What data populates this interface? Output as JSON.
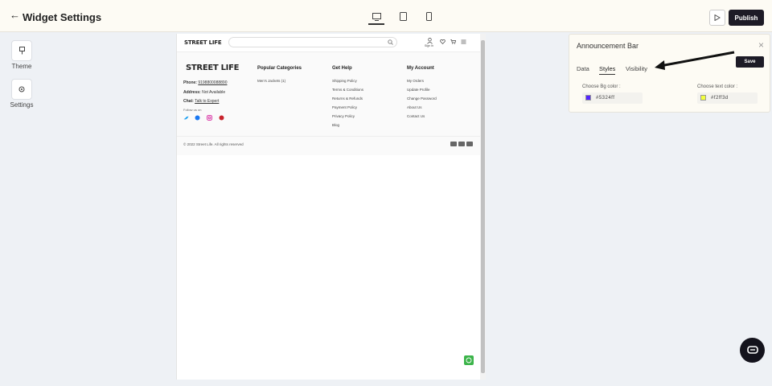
{
  "topbar": {
    "title": "Widget Settings",
    "devices": [
      "desktop-icon",
      "tablet-icon",
      "mobile-icon"
    ],
    "active_device": "desktop",
    "publish_label": "Publish"
  },
  "sidebar": {
    "items": [
      {
        "label": "Theme",
        "icon": "brush-icon"
      },
      {
        "label": "Settings",
        "icon": "gear-icon"
      }
    ]
  },
  "preview": {
    "header": {
      "logo": "STREET LIFE",
      "signin": "Sign In"
    },
    "footer": {
      "logo": "STREET LIFE",
      "phone_label": "Phone:",
      "phone": "9198800088890",
      "address_label": "Address:",
      "address": "Not Available",
      "chat_label": "Chat:",
      "chat": "Talk to Expert",
      "follow": "Follow us on",
      "columns": [
        {
          "heading": "Popular Categories",
          "items": [
            "Men's Jackets (1)"
          ]
        },
        {
          "heading": "Get Help",
          "items": [
            "Shipping Policy",
            "Terms & Conditions",
            "Returns & Refunds",
            "Payment Policy",
            "Privacy Policy",
            "Blog"
          ]
        },
        {
          "heading": "My Account",
          "items": [
            "My Orders",
            "Update Profile",
            "Change Password",
            "About Us",
            "Contact Us"
          ]
        }
      ],
      "copyright": "© 2022 Street Life. All rights reserved"
    }
  },
  "panel": {
    "title": "Announcement Bar",
    "save_label": "Save",
    "tabs": [
      "Data",
      "Styles",
      "Visibility"
    ],
    "active_tab": "Styles",
    "bg_label": "Choose Bg color :",
    "bg_value": "#5324ff",
    "text_label": "Choose text color :",
    "text_value": "#f2ff3d"
  },
  "colors": {
    "accent_dark": "#1d1b26",
    "bg_swatch": "#5324ff",
    "text_swatch": "#f2ff3d",
    "whatsapp": "#3cb44a"
  }
}
